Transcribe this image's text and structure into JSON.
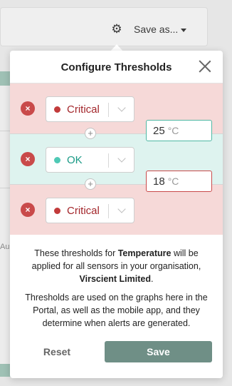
{
  "background": {
    "save_menu_label": "Save as...",
    "gear_icon": "gear-icon",
    "axis_text": "Au"
  },
  "modal": {
    "title": "Configure Thresholds",
    "close_icon": "close-icon",
    "rows": [
      {
        "status": "Critical",
        "color": "#c94a4a",
        "text_color": "#a3262b",
        "dot": "#c23b3b"
      },
      {
        "status": "OK",
        "color": "#1aa591",
        "text_color": "#1a9a86",
        "dot": "#4fc9b5"
      },
      {
        "status": "Critical",
        "color": "#c94a4a",
        "text_color": "#a3262b",
        "dot": "#c23b3b"
      }
    ],
    "thresholds": [
      {
        "value": "25",
        "unit": "°C",
        "border": "#4fb8a4"
      },
      {
        "value": "18",
        "unit": "°C",
        "border": "#c94a4a"
      }
    ],
    "add_icon": "+",
    "remove_icon": "×",
    "description": {
      "p1_a": "These thresholds for ",
      "p1_b": "Temperature",
      "p1_c": " will be applied for all sensors in your organisation, ",
      "p1_d": "Virscient Limited",
      "p1_e": ".",
      "p2": "Thresholds are used on the graphs here in the Portal, as well as the mobile app, and they determine when alerts are generated."
    },
    "reset_label": "Reset",
    "save_label": "Save"
  },
  "colors": {
    "save_button": "#6f8f86",
    "critical_band": "#f6d9d8",
    "ok_band": "#def3ef"
  }
}
